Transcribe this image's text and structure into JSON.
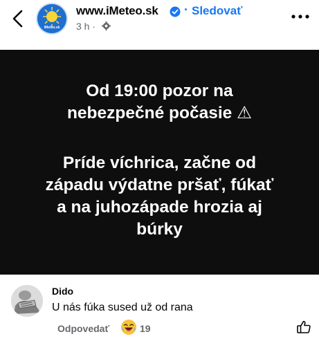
{
  "header": {
    "page_name": "www.iMeteo.sk",
    "separator": "·",
    "follow_label": "Sledovať",
    "time": "3 h ·",
    "avatar_text": "iMeteo.sk"
  },
  "post": {
    "line1": "Od 19:00 pozor na\nnebezpečné počasie ⚠",
    "line2": "Príde víchrica, začne od\nzápadu výdatne pršať, fúkať\na na juhozápade hrozia aj\nbúrky"
  },
  "comment": {
    "author": "Dido",
    "text": "U nás fúka sused už od rana",
    "reply_label": "Odpovedať",
    "reaction_count": "19"
  },
  "colors": {
    "accent": "#1877f2",
    "post_bg": "#0e0e0e",
    "muted": "#65676b"
  }
}
